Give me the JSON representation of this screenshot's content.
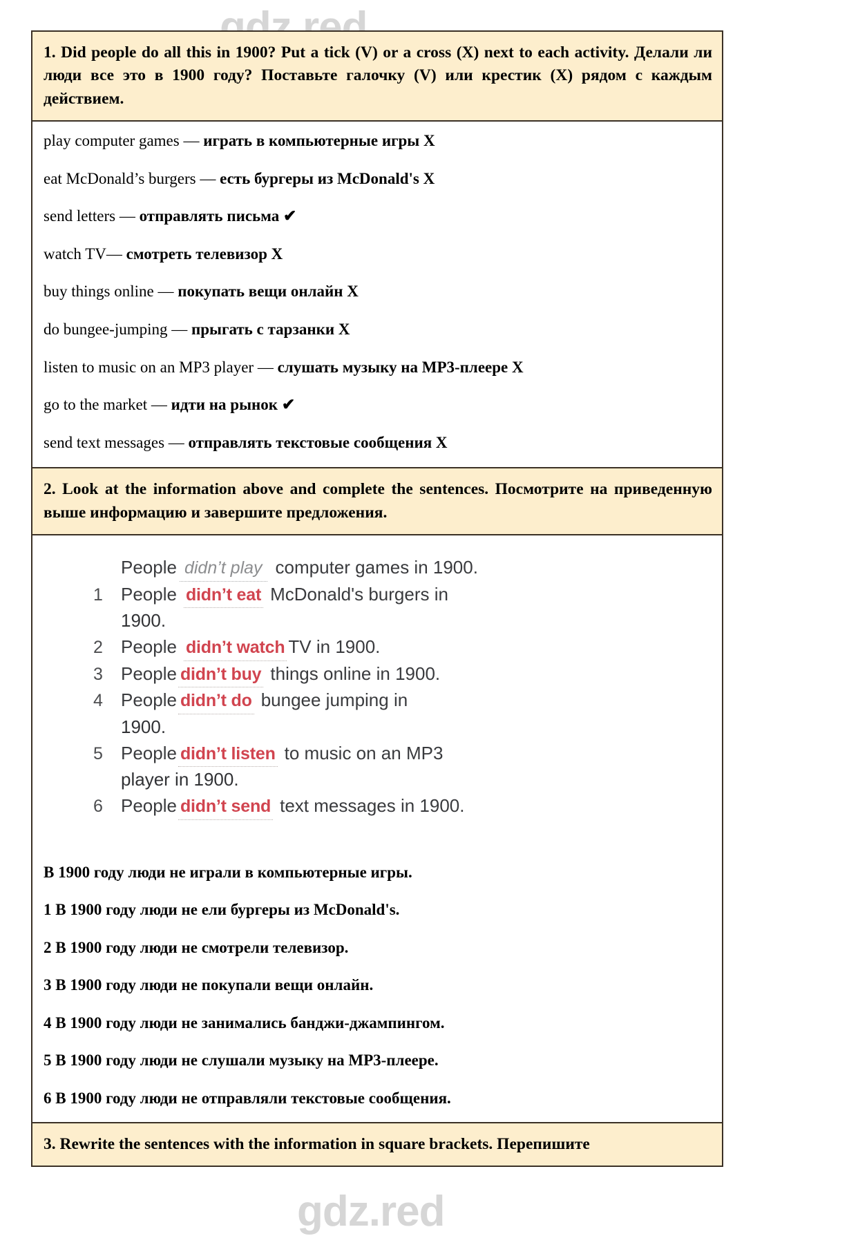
{
  "watermark": {
    "text": "gdz.red"
  },
  "colors": {
    "task_header_bg": "#fdeecd",
    "border": "#3a3025",
    "answer_red": "#d9404c",
    "example_gray": "#8c8d90"
  },
  "task1": {
    "header": "1. Did people do all this in 1900? Put a tick (V) or a cross (X) next to each activity. Делали ли люди все это в 1900 году? Поставьте галочку (V) или крестик (X) рядом с каждым действием.",
    "activities": [
      {
        "en": "play computer games — ",
        "ru": "играть в компьютерные игры",
        "mark": "X"
      },
      {
        "en": "eat McDonald’s burgers — ",
        "ru": "есть бургеры из McDonald's",
        "mark": "X"
      },
      {
        "en": "send letters — ",
        "ru": "отправлять письма",
        "mark": "✔"
      },
      {
        "en": "watch TV— ",
        "ru": " смотреть телевизор",
        "mark": "X"
      },
      {
        "en": "buy things online — ",
        "ru": "покупать вещи онлайн",
        "mark": "X"
      },
      {
        "en": "do bungee-jumping — ",
        "ru": "прыгать с тарзанки",
        "mark": "X"
      },
      {
        "en": "listen to music on an MP3 player — ",
        "ru": "слушать музыку на MP3-плеере",
        "mark": "X"
      },
      {
        "en": "go to the market — ",
        "ru": "идти на рынок",
        "mark": "✔"
      },
      {
        "en": "send text messages — ",
        "ru": "отправлять текстовые сообщения",
        "mark": "X"
      }
    ]
  },
  "task2": {
    "header": "2. Look at the  information above and complete the sentences. Посмотрите на приведенную выше информацию и завершите предложения.",
    "scan": {
      "example": {
        "prefix": "People",
        "blank": "didn’t play",
        "suffix": "computer games in 1900."
      },
      "items": [
        {
          "num": "1",
          "prefix": "People",
          "blank": "didn’t eat",
          "suffix": "McDonald's burgers in",
          "cont": "1900."
        },
        {
          "num": "2",
          "prefix": "People",
          "blank": "didn’t watch",
          "suffix": "TV in 1900.",
          "cont": ""
        },
        {
          "num": "3",
          "prefix": "People",
          "blank": "didn’t buy",
          "suffix": "things online in 1900.",
          "cont": ""
        },
        {
          "num": "4",
          "prefix": "People",
          "blank": "didn’t do",
          "suffix": "bungee jumping in",
          "cont": "1900."
        },
        {
          "num": "5",
          "prefix": "People",
          "blank": "didn’t listen",
          "suffix": "to music on an MP3",
          "cont": "player in 1900."
        },
        {
          "num": "6",
          "prefix": "People",
          "blank": "didn’t send",
          "suffix": "text messages in 1900.",
          "cont": ""
        }
      ]
    },
    "translations": [
      "В 1900 году люди не играли в компьютерные игры.",
      "1 В 1900 году люди не ели бургеры из McDonald's.",
      "2 В 1900 году люди не смотрели телевизор.",
      "3 В 1900 году люди не покупали вещи онлайн.",
      "4 В 1900 году люди не занимались банджи-джампингом.",
      "5 В 1900 году люди не слушали музыку на MP3-плеере.",
      "6 В 1900 году люди не отправляли текстовые сообщения."
    ]
  },
  "task3": {
    "header": "3. Rewrite the sentences with the information in square brackets. Перепишите"
  }
}
